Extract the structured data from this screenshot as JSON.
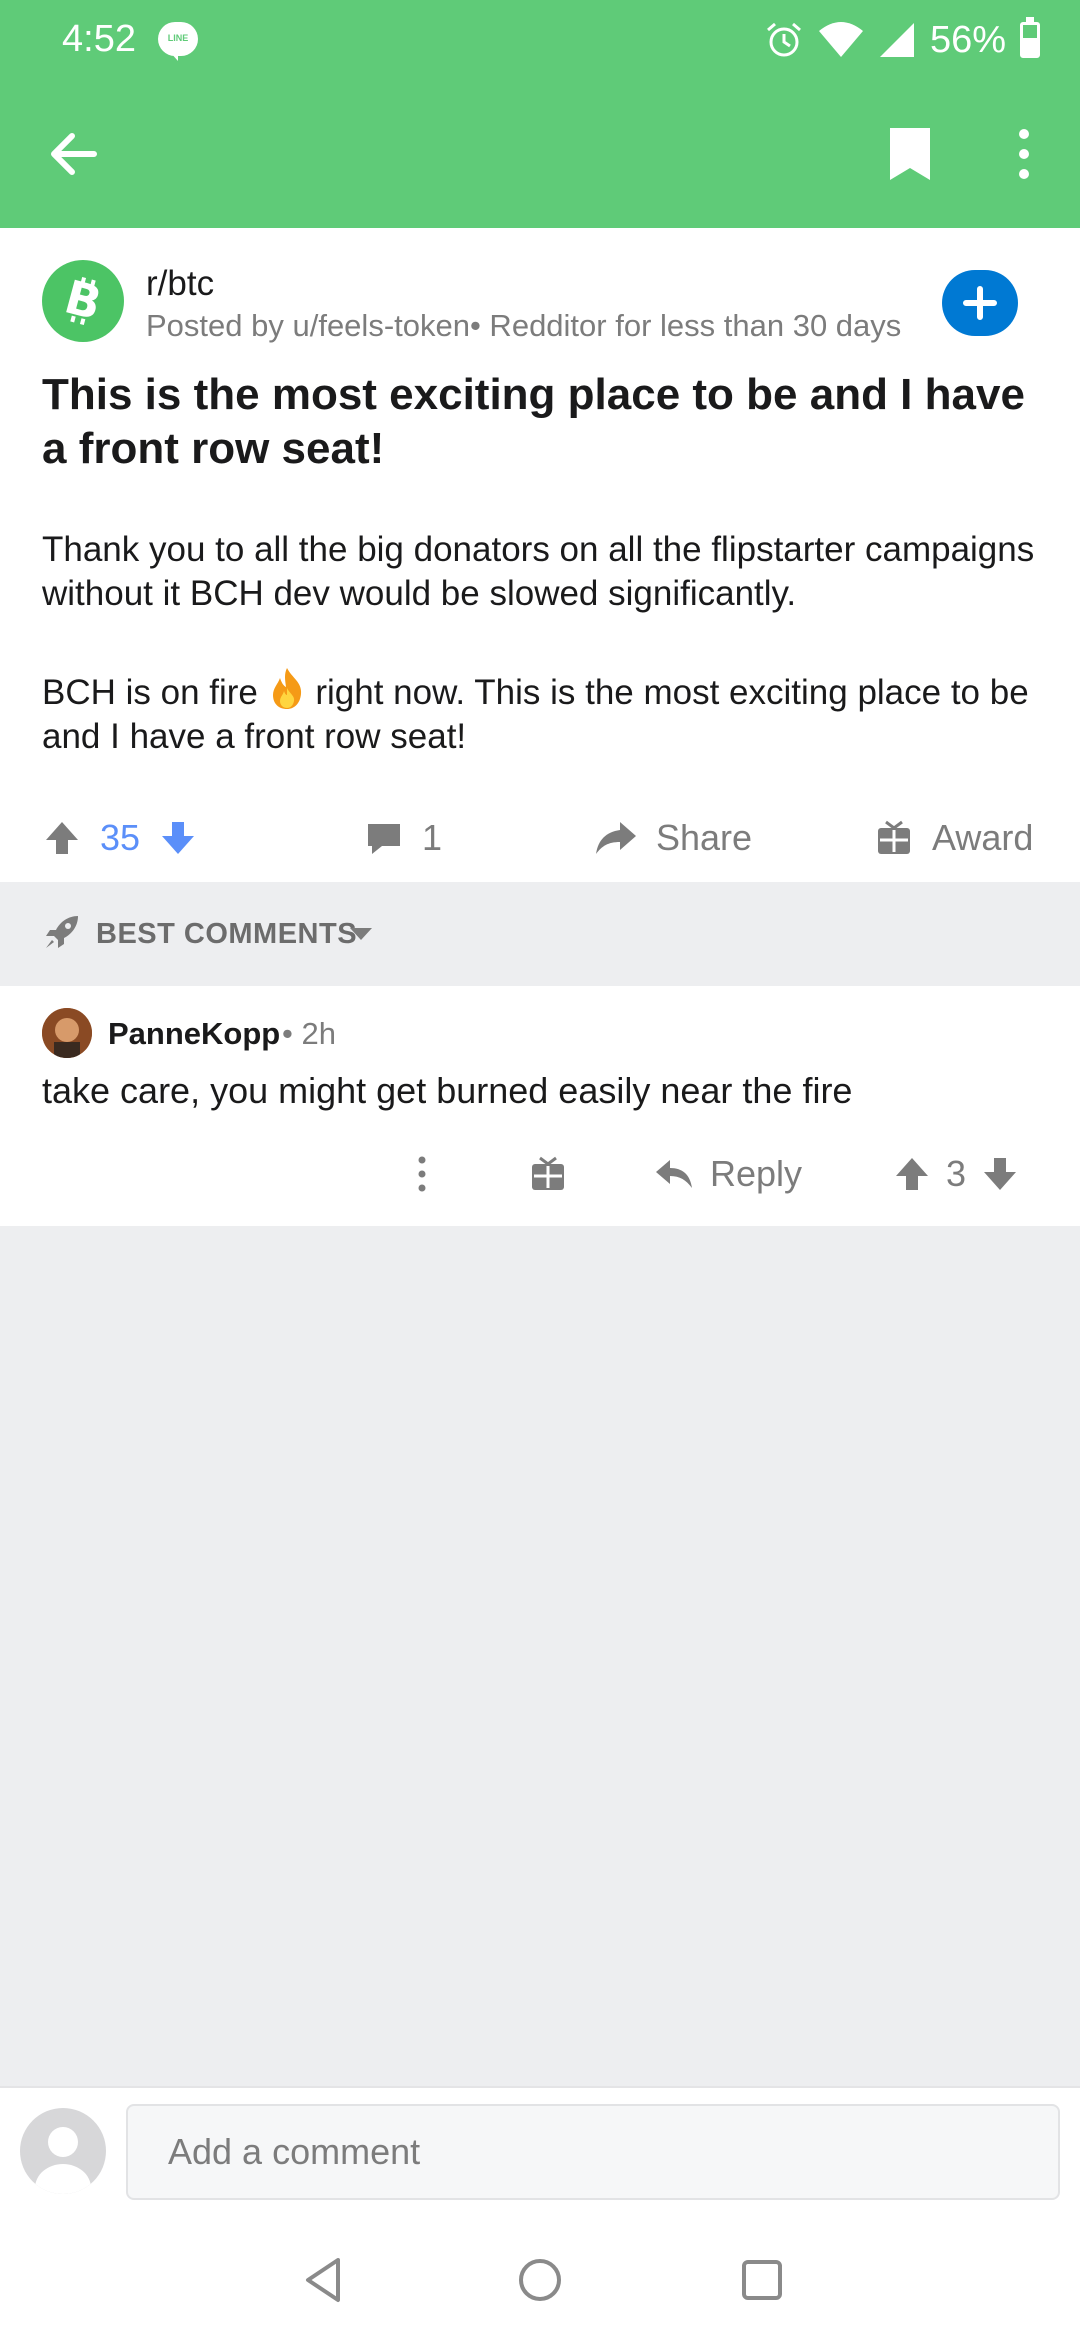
{
  "status_bar": {
    "time": "4:52",
    "line_badge": "LINE",
    "battery_percent": "56%",
    "battery_level": 0.56,
    "icons": [
      "alarm-icon",
      "wifi-icon",
      "signal-icon",
      "battery-icon"
    ]
  },
  "app_bar": {
    "icons": [
      "back-arrow-icon",
      "bookmark-icon",
      "more-vert-icon"
    ]
  },
  "post": {
    "subreddit": "r/btc",
    "posted_by": "Posted by u/feels-token• Redditor for less than 30 days",
    "title": "This is the most exciting place to be and I have a front row seat!",
    "body_p1": "Thank you to all the big donators on all the flipstarter campaigns without it BCH dev would be slowed significantly.",
    "body_p2_before": "BCH is on fire ",
    "body_p2_after": " right now. This is the most exciting place to be and I have a front row seat!",
    "score": "35",
    "comment_count": "1",
    "share_label": "Share",
    "award_label": "Award",
    "accent_color": "#5b8ff9"
  },
  "comments_header": {
    "sort_label": "BEST COMMENTS"
  },
  "comments": [
    {
      "author": "PanneKopp",
      "time": "• 2h",
      "text": "take care, you might get burned easily near the fire",
      "reply_label": "Reply",
      "score": "3"
    }
  ],
  "composer": {
    "placeholder": "Add a comment"
  },
  "colors": {
    "app_bar": "#5fcb78",
    "join_button": "#0079d3",
    "feed_background": "#edeef0"
  }
}
